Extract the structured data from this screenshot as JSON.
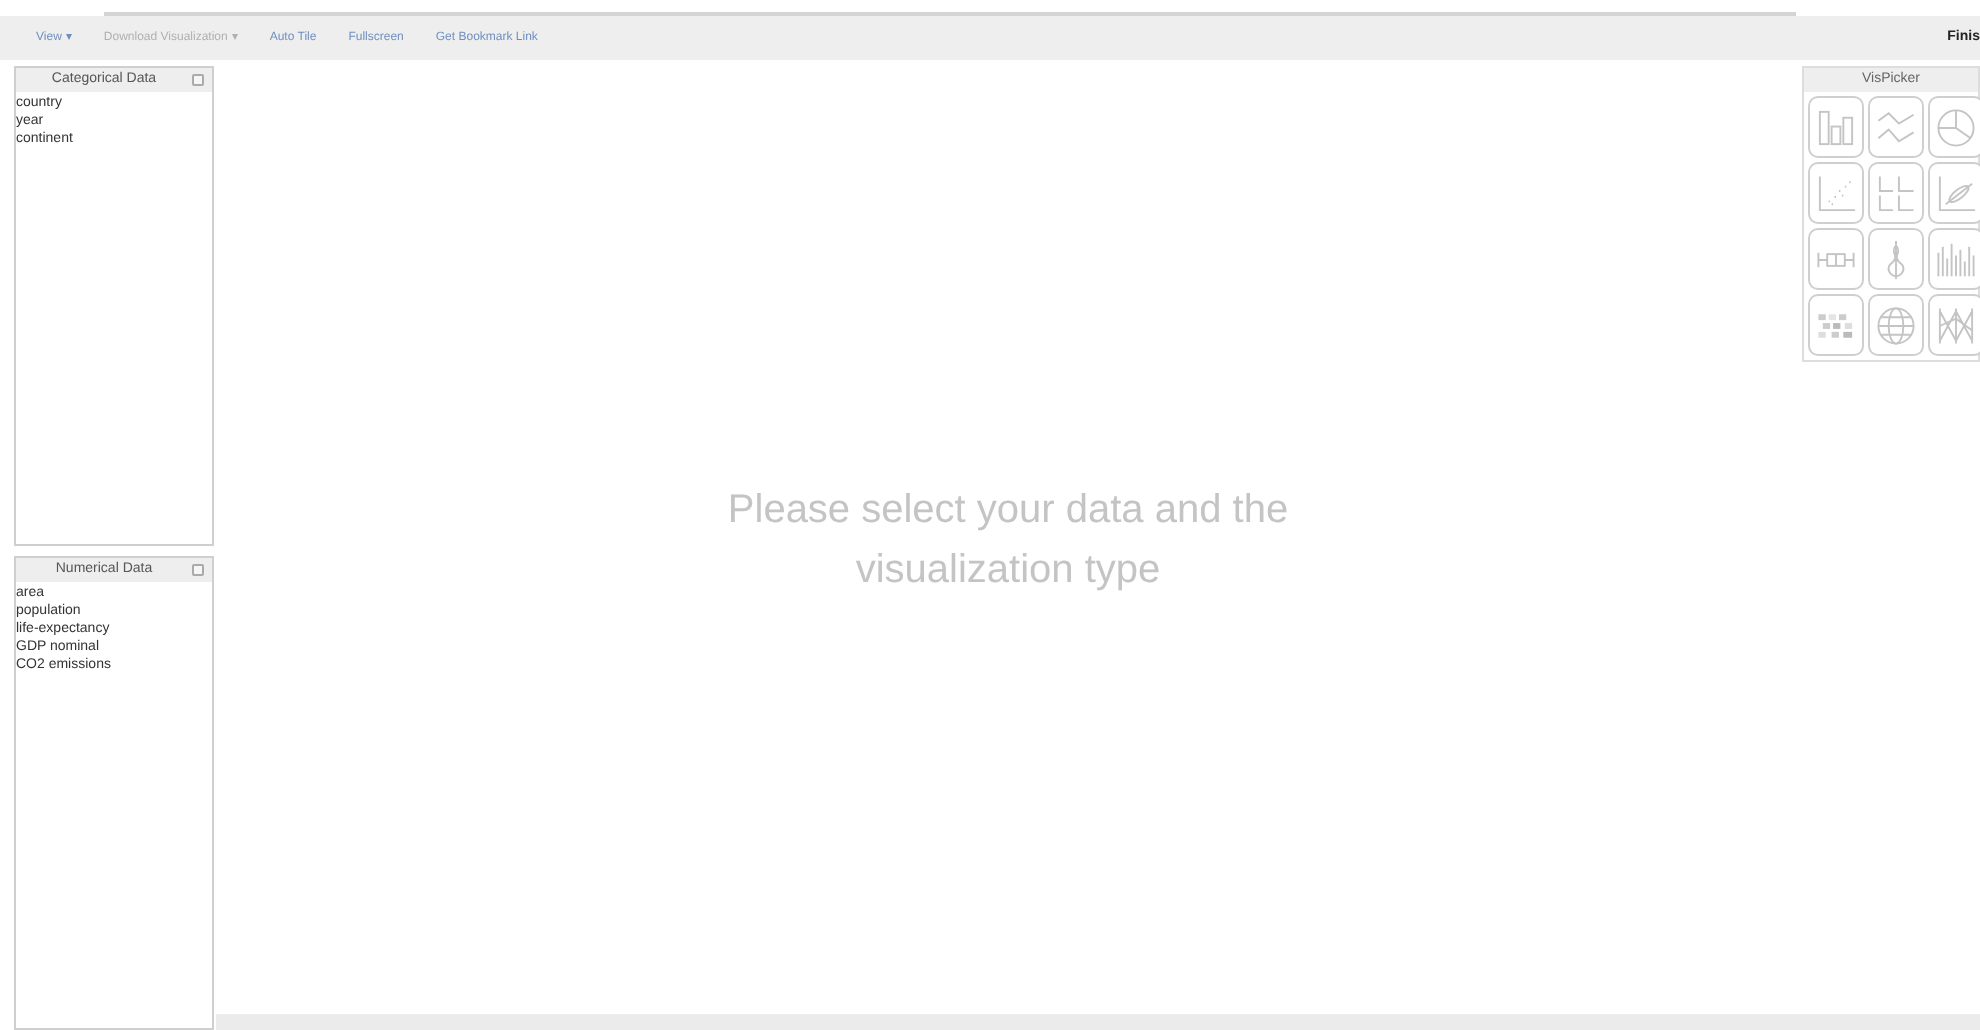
{
  "menu": [
    {
      "label": "View",
      "caret": "▾",
      "disabled": false
    },
    {
      "label": "Download Visualization",
      "caret": "▾",
      "disabled": true
    },
    {
      "label": "Auto Tile",
      "disabled": false
    },
    {
      "label": "Fullscreen",
      "disabled": false
    },
    {
      "label": "Get Bookmark Link",
      "disabled": false
    }
  ],
  "finish": "Finis",
  "panels": [
    {
      "title": "Categorical Data",
      "checked": false,
      "items": [
        "country",
        "year",
        "continent"
      ]
    },
    {
      "title": "Numerical Data",
      "checked": false,
      "items": [
        "area",
        "population",
        "life-expectancy",
        "GDP nominal",
        "CO2 emissions"
      ]
    }
  ],
  "message": "Please select your data and the visualization type",
  "vispicker": {
    "title": "VisPicker",
    "buttons": [
      {
        "kind": "bar"
      },
      {
        "kind": "line"
      },
      {
        "kind": "pie"
      },
      {
        "kind": "scatter"
      },
      {
        "kind": "matrix"
      },
      {
        "kind": "regression"
      },
      {
        "kind": "box"
      },
      {
        "kind": "violin"
      },
      {
        "kind": "histogram"
      },
      {
        "kind": "heatmap"
      },
      {
        "kind": "globe"
      },
      {
        "kind": "parallel"
      }
    ]
  }
}
